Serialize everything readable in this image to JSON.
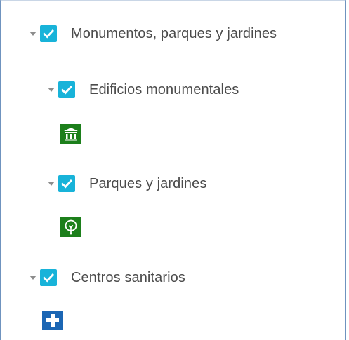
{
  "layers": [
    {
      "label": "Monumentos, parques y jardines",
      "checked": true,
      "expanded": true,
      "icons": {
        "expander": "caret-down-icon",
        "checkbox": "checkmark-icon"
      }
    },
    {
      "label": "Edificios monumentales",
      "checked": true,
      "expanded": true,
      "legend_icon": "monument-building-icon",
      "legend_color": "#1c7f1b"
    },
    {
      "label": "Parques y jardines",
      "checked": true,
      "expanded": true,
      "legend_icon": "tree-icon",
      "legend_color": "#1c7f1b"
    },
    {
      "label": "Centros sanitarios",
      "checked": true,
      "expanded": true,
      "legend_icon": "medical-cross-icon",
      "legend_color": "#1b66b4"
    }
  ],
  "colors": {
    "checkbox": "#18b3d9",
    "border": "#6f93bf",
    "text": "#4b4b4b"
  }
}
